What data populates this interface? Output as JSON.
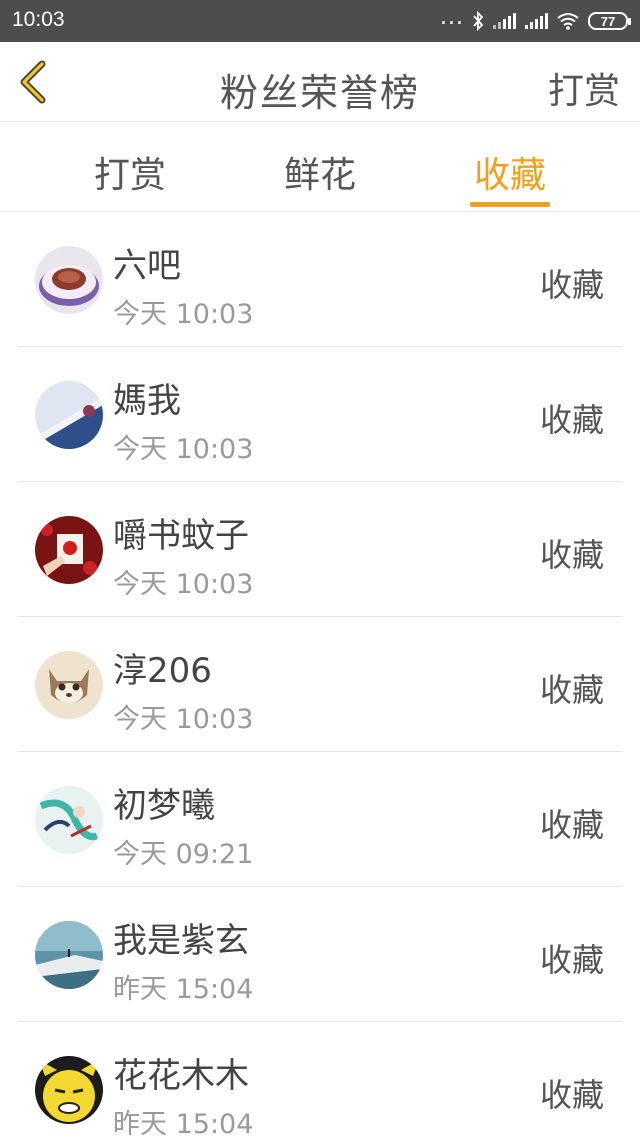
{
  "status_bar": {
    "time": "10:03",
    "dots": "...",
    "battery": "77",
    "icons": [
      "bluetooth-icon",
      "signal-icon",
      "signal-icon",
      "wifi-icon",
      "battery-icon"
    ]
  },
  "header": {
    "title": "粉丝荣誉榜",
    "right_action": "打赏",
    "back_icon": "chevron-left-icon"
  },
  "tabs": [
    {
      "label": "打赏",
      "active": false
    },
    {
      "label": "鲜花",
      "active": false
    },
    {
      "label": "收藏",
      "active": true
    }
  ],
  "colors": {
    "accent": "#f0a01e",
    "status_bar_bg": "#4d4d4d",
    "divider": "#e6e6e6",
    "muted_text": "#9a9a9a"
  },
  "fans": [
    {
      "name": "六吧",
      "time": "今天 10:03",
      "action": "收藏"
    },
    {
      "name": "媽我",
      "time": "今天 10:03",
      "action": "收藏"
    },
    {
      "name": "嚼书蚊子",
      "time": "今天 10:03",
      "action": "收藏"
    },
    {
      "name": "淳206",
      "time": "今天 10:03",
      "action": "收藏"
    },
    {
      "name": "初梦曦",
      "time": "今天 09:21",
      "action": "收藏"
    },
    {
      "name": "我是紫玄",
      "time": "昨天 15:04",
      "action": "收藏"
    },
    {
      "name": "花花木木",
      "time": "昨天 15:04",
      "action": "收藏"
    }
  ]
}
